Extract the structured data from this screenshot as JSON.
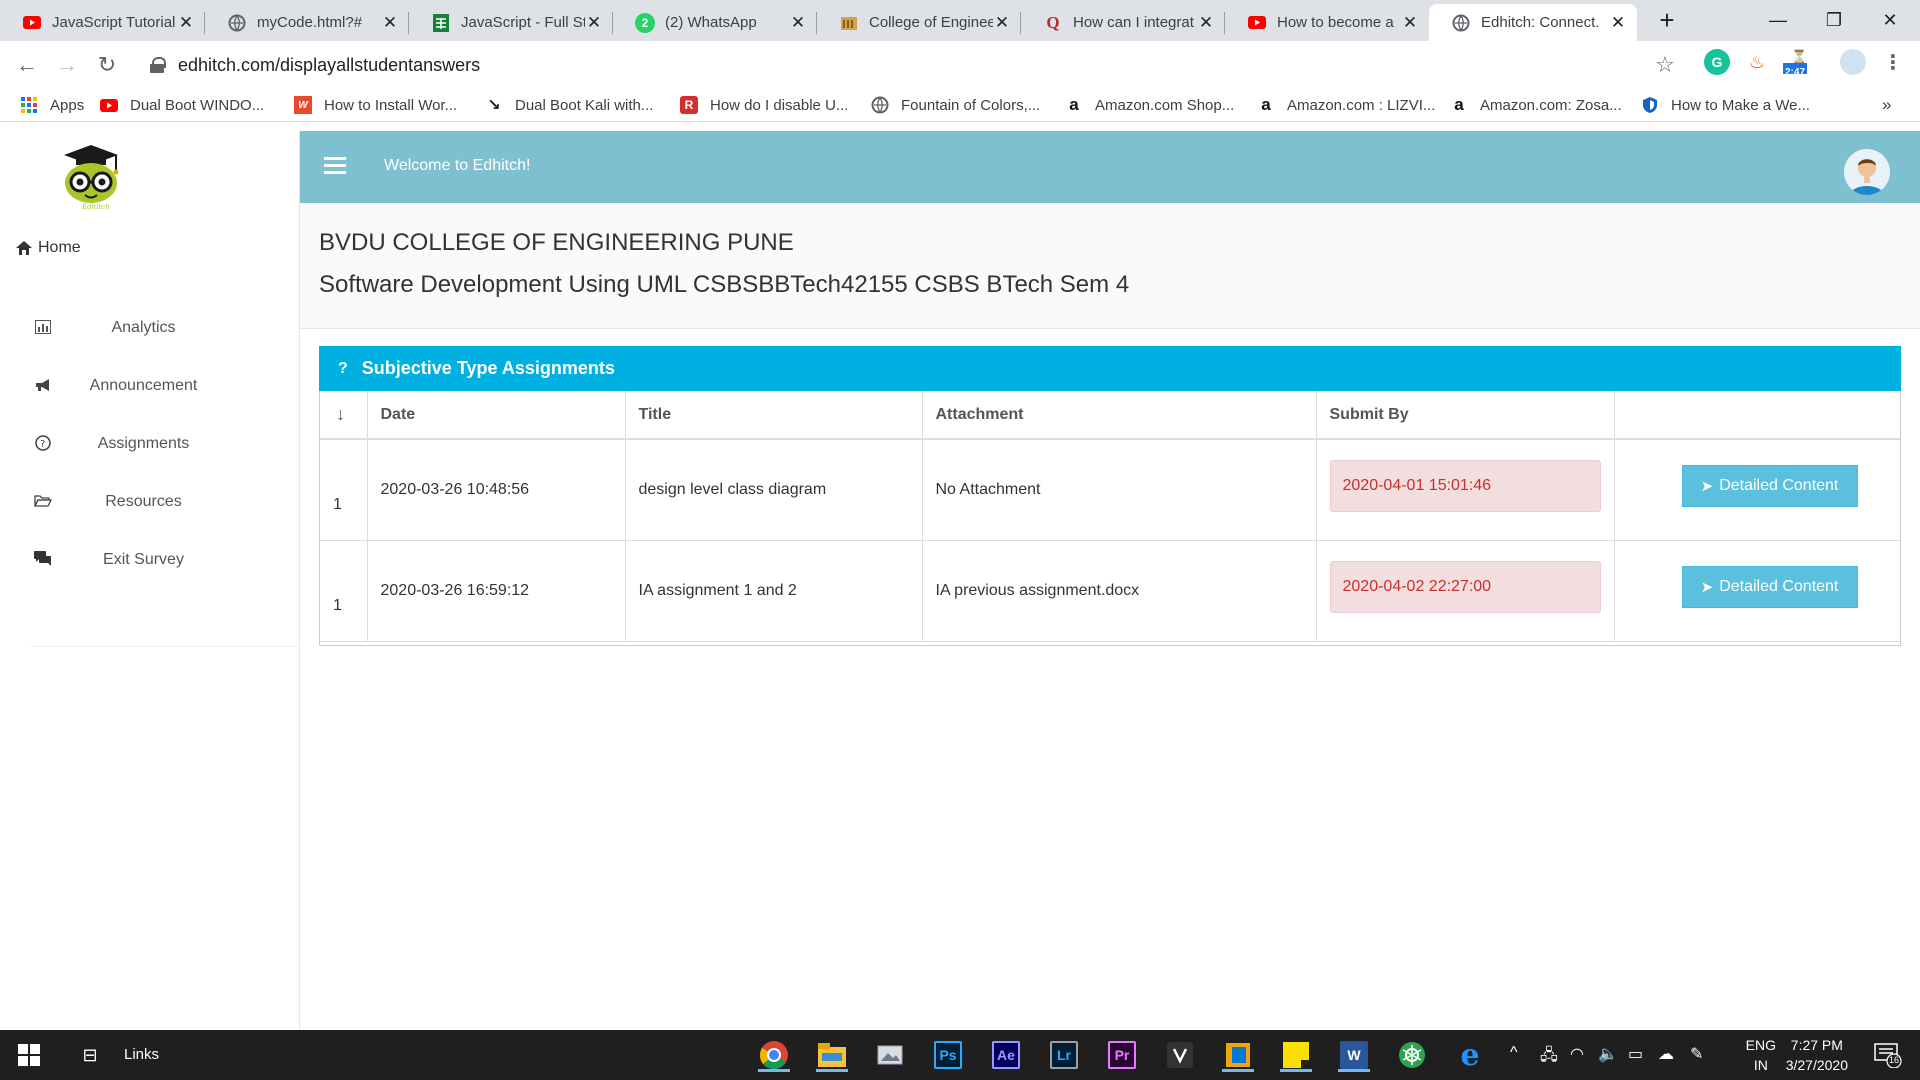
{
  "browser": {
    "tabs": [
      {
        "title": "JavaScript Tutorial",
        "favicon": "youtube-icon"
      },
      {
        "title": "myCode.html?#",
        "favicon": "globe-icon"
      },
      {
        "title": "JavaScript - Full St",
        "favicon": "sheets-icon"
      },
      {
        "title": "(2) WhatsApp",
        "favicon": "whatsapp-icon",
        "badge": "2"
      },
      {
        "title": "College of Enginee",
        "favicon": "college-icon"
      },
      {
        "title": "How can I integrat",
        "favicon": "quora-icon"
      },
      {
        "title": "How to become a",
        "favicon": "youtube-icon"
      },
      {
        "title": "Edhitch: Connect.",
        "favicon": "globe-icon",
        "active": true
      }
    ],
    "url": "edhitch.com/displayallstudentanswers",
    "extension_badge_time": "2:47",
    "bookmarks": [
      {
        "label": "Apps",
        "icon": "apps-grid-icon"
      },
      {
        "label": "Dual Boot WINDO...",
        "icon": "youtube-icon"
      },
      {
        "label": "How to Install Wor...",
        "icon": "wp-icon"
      },
      {
        "label": "Dual Boot Kali with...",
        "icon": "kali-icon"
      },
      {
        "label": "How do I disable U...",
        "icon": "bookmark-red-icon"
      },
      {
        "label": "Fountain of Colors,...",
        "icon": "globe-icon"
      },
      {
        "label": "Amazon.com Shop...",
        "icon": "amazon-icon"
      },
      {
        "label": "Amazon.com : LIZVI...",
        "icon": "amazon-icon"
      },
      {
        "label": "Amazon.com: Zosa...",
        "icon": "amazon-icon"
      },
      {
        "label": "How to Make a We...",
        "icon": "shield-icon"
      }
    ],
    "bookmarks_more": "»"
  },
  "app": {
    "logo_caption": "Edhitch",
    "welcome": "Welcome to Edhitch!",
    "sidebar": {
      "home": "Home",
      "items": [
        {
          "label": "Analytics",
          "icon": "bar-chart-icon"
        },
        {
          "label": "Announcement",
          "icon": "bullhorn-icon"
        },
        {
          "label": "Assignments",
          "icon": "question-circle-icon"
        },
        {
          "label": "Resources",
          "icon": "folder-open-icon"
        },
        {
          "label": "Exit Survey",
          "icon": "comments-icon"
        }
      ]
    },
    "college": "BVDU COLLEGE OF ENGINEERING PUNE",
    "course": "Software Development Using UML CSBSBBTech42155 CSBS BTech Sem 4",
    "panel_title": "Subjective Type Assignments",
    "table": {
      "sort_glyph": "↓",
      "headers": [
        "Date",
        "Title",
        "Attachment",
        "Submit By"
      ],
      "rows": [
        {
          "num": "1",
          "date": "2020-03-26 10:48:56",
          "title": "design level class diagram",
          "attachment": "No Attachment",
          "submit_by": "2020-04-01 15:01:46",
          "action": "Detailed Content"
        },
        {
          "num": "1",
          "date": "2020-03-26 16:59:12",
          "title": "IA assignment 1 and 2",
          "attachment": "IA previous assignment.docx",
          "submit_by": "2020-04-02 22:27:00",
          "action": "Detailed Content"
        }
      ]
    }
  },
  "taskbar": {
    "links_label": "Links",
    "apps": [
      "Ps",
      "Ae",
      "Lr",
      "Pr",
      "W"
    ],
    "lang_top": "ENG",
    "lang_bottom": "IN",
    "time": "7:27 PM",
    "date": "3/27/2020",
    "notification_count": "16"
  },
  "colors": {
    "topbar": "#7fc0d0",
    "panel_header": "#00b0e0",
    "button": "#5bc0de",
    "deadline_bg": "#f2dede",
    "deadline_text": "#c9302c"
  }
}
